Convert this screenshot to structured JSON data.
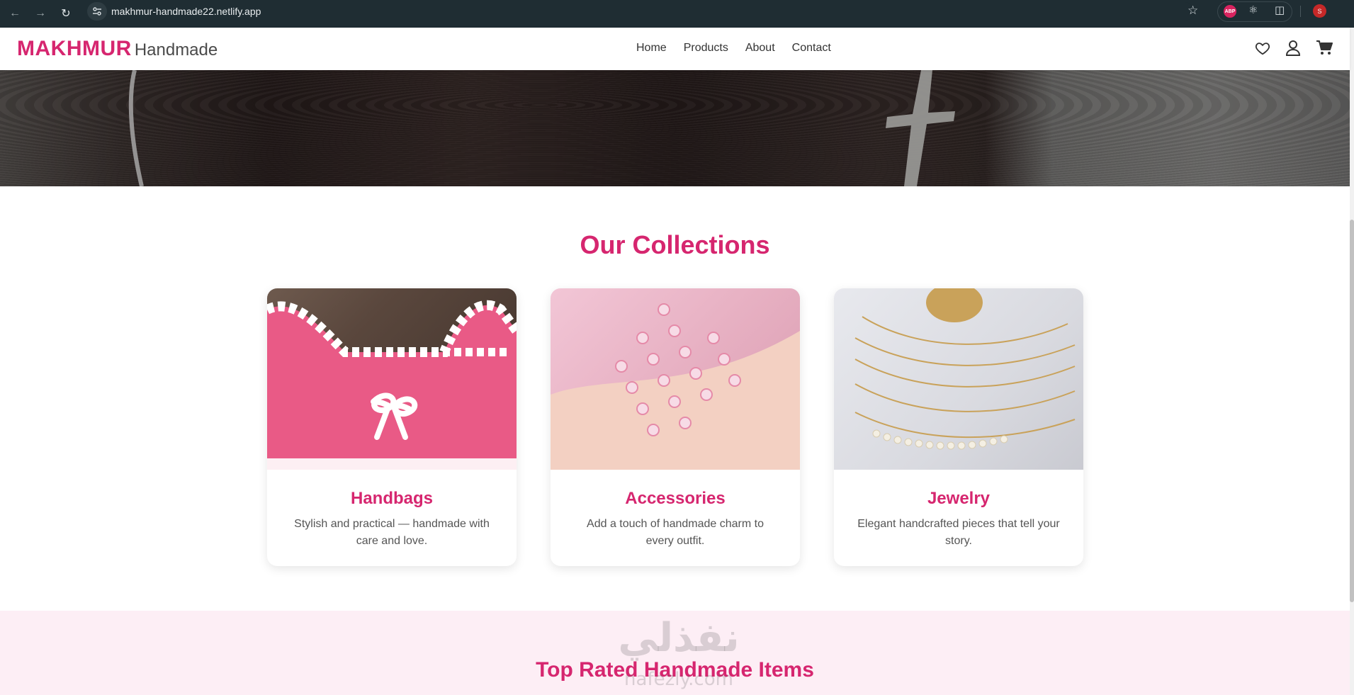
{
  "browser": {
    "url": "makhmur-handmade22.netlify.app",
    "extension_abp_label": "ABP",
    "profile_initial": "S"
  },
  "header": {
    "logo_main": "MAKHMUR",
    "logo_sub": "Handmade",
    "nav": [
      "Home",
      "Products",
      "About",
      "Contact"
    ],
    "icons": [
      "heart-icon",
      "user-icon",
      "cart-icon"
    ]
  },
  "collections": {
    "title": "Our Collections",
    "items": [
      {
        "name": "Handbags",
        "description": "Stylish and practical — handmade with care and love."
      },
      {
        "name": "Accessories",
        "description": "Add a touch of handmade charm to every outfit."
      },
      {
        "name": "Jewelry",
        "description": "Elegant handcrafted pieces that tell your story."
      }
    ]
  },
  "top_rated": {
    "title": "Top Rated Handmade Items"
  },
  "watermark": {
    "text": "نفذلي",
    "sub": "nafezly.com"
  },
  "colors": {
    "brand": "#d6266f",
    "browser_bar": "#1f2d33",
    "section_bg": "#fdeef5"
  }
}
